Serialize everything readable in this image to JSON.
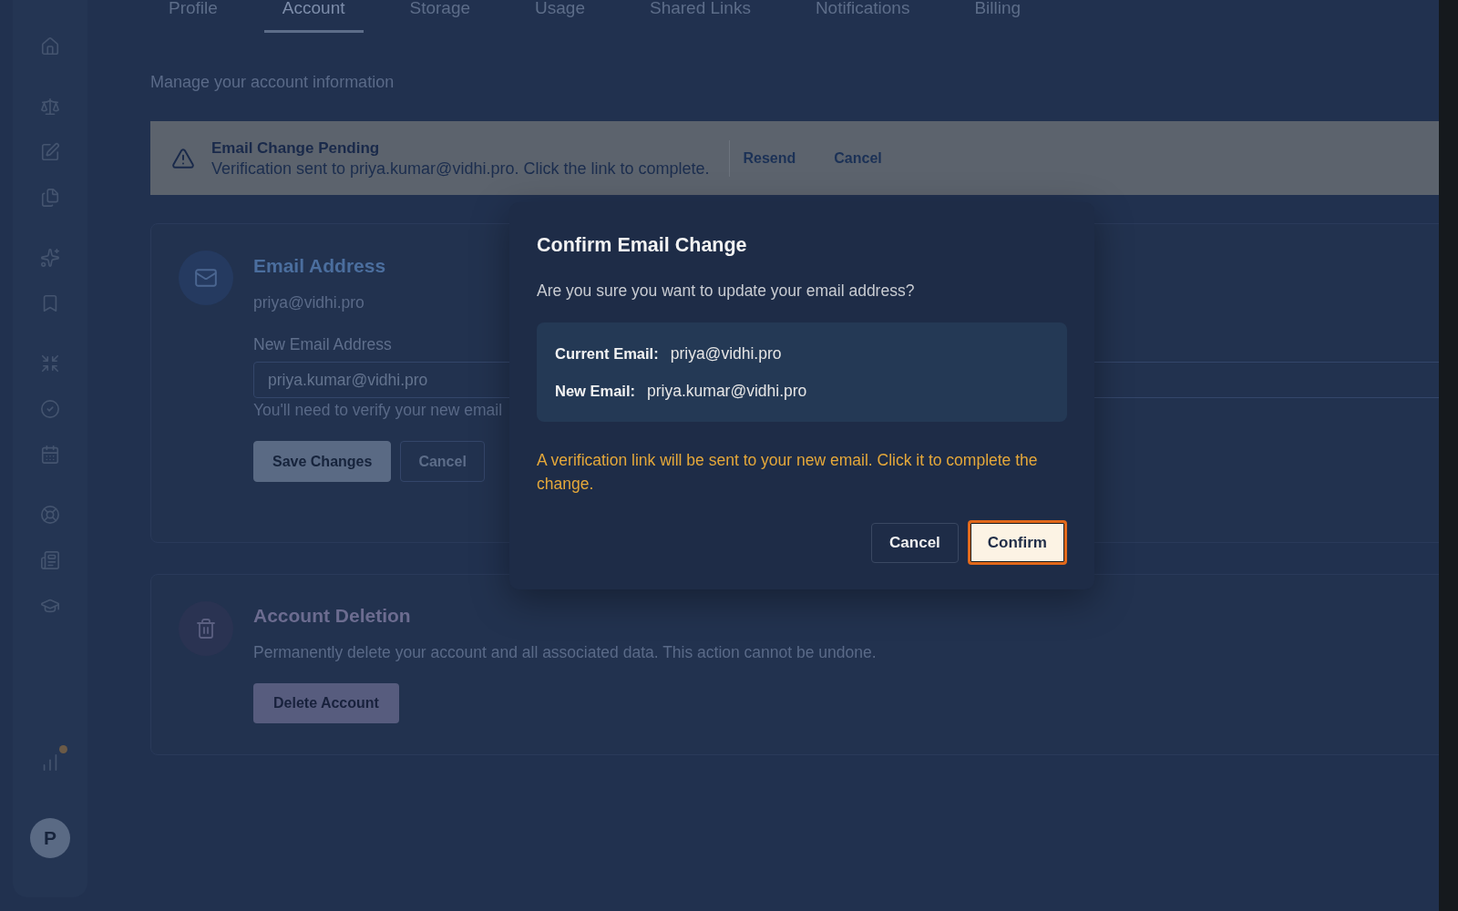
{
  "sidebar": {
    "notification_dot": true,
    "avatar": {
      "initial": "P"
    }
  },
  "tabs": [
    {
      "label": "Profile",
      "selected": false
    },
    {
      "label": "Account",
      "selected": true
    },
    {
      "label": "Storage",
      "selected": false
    },
    {
      "label": "Usage",
      "selected": false
    },
    {
      "label": "Shared Links",
      "selected": false
    },
    {
      "label": "Notifications",
      "selected": false
    },
    {
      "label": "Billing",
      "selected": false
    }
  ],
  "subtitle": "Manage your account information",
  "pending_banner": {
    "title": "Email Change Pending",
    "message": "Verification sent to priya.kumar@vidhi.pro. Click the link to complete.",
    "actions": [
      "Resend",
      "Cancel"
    ]
  },
  "email_card": {
    "title": "Email Address",
    "current_email": "priya@vidhi.pro",
    "field": {
      "label": "New Email Address",
      "value": "priya.kumar@vidhi.pro"
    },
    "hint": "You'll need to verify your new email",
    "buttons": [
      {
        "label": "Save Changes",
        "kind": "primary"
      },
      {
        "label": "Cancel",
        "kind": "secondary"
      }
    ]
  },
  "deletion_card": {
    "title": "Account Deletion",
    "description": "Permanently delete your account and all associated data. This action cannot be undone.",
    "button": "Delete Account"
  },
  "dialog": {
    "title": "Confirm Email Change",
    "question": "Are you sure you want to update your email address?",
    "details": [
      {
        "label": "Current Email:",
        "value": "priya@vidhi.pro"
      },
      {
        "label": "New Email:",
        "value": "priya.kumar@vidhi.pro"
      }
    ],
    "warning": "A verification link will be sent to your new email. Click it to complete the change.",
    "buttons": [
      {
        "label": "Cancel",
        "kind": "secondary",
        "focused": false
      },
      {
        "label": "Confirm",
        "kind": "primary",
        "focused": true
      }
    ]
  }
}
